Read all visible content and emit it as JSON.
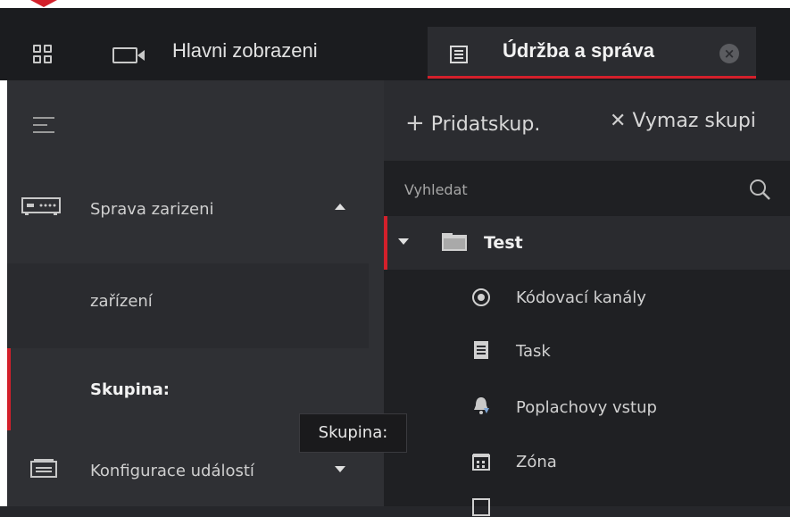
{
  "tabs": [
    {
      "label": "Hlavni zobrazeni",
      "icon": "camera-icon"
    },
    {
      "label": "Údržba a správa",
      "icon": "maintenance-icon",
      "active": true
    }
  ],
  "sidebar": {
    "items": [
      {
        "label": "Sprava zarizeni",
        "icon": "device-icon",
        "expanded": true
      },
      {
        "label": "zařízení"
      },
      {
        "label": "Skupina:",
        "selected": true
      },
      {
        "label": "Konfigurace událostí",
        "icon": "event-config-icon",
        "expanded": false
      }
    ]
  },
  "tooltip": {
    "text": "Skupina:"
  },
  "toolbar": {
    "add_label": "Pridatskup.",
    "delete_label": "Vymaz skupi"
  },
  "search": {
    "placeholder": "Vyhledat"
  },
  "tree": {
    "group": "Test",
    "items": [
      {
        "label": "Kódovací kanály",
        "icon": "encoding-channel-icon"
      },
      {
        "label": "Task",
        "icon": "task-icon"
      },
      {
        "label": "Poplachovy vstup",
        "icon": "alarm-input-icon"
      },
      {
        "label": "Zóna",
        "icon": "zone-icon"
      }
    ]
  },
  "colors": {
    "accent": "#d3202b",
    "background": "#26272b"
  }
}
